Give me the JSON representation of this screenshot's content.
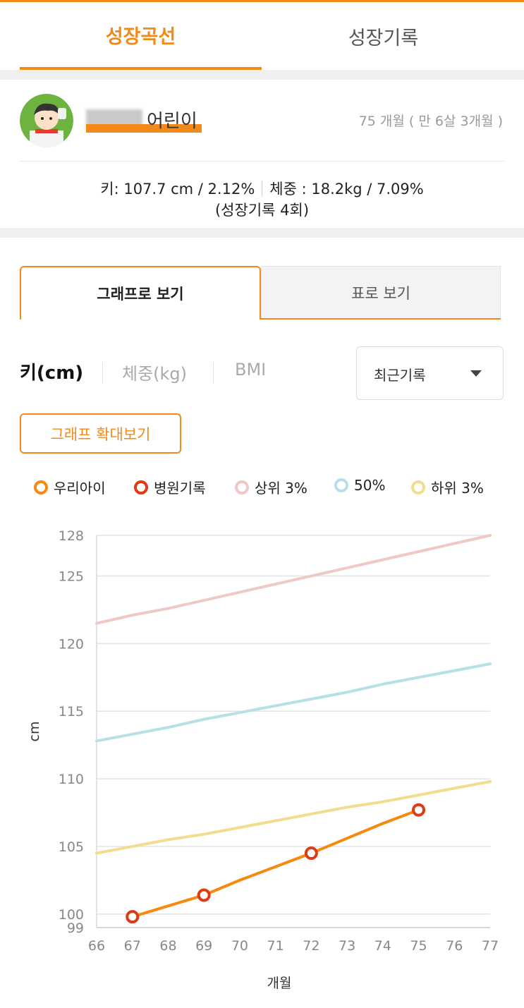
{
  "tabs": {
    "growth_curve": "성장곡선",
    "growth_records": "성장기록"
  },
  "profile": {
    "child_label": "어린이",
    "age_text": "75 개월 ( 만 6살 3개월 )",
    "height_stat": "키: 107.7 cm / 2.12%",
    "weight_stat": "체중 : 18.2kg / 7.09%",
    "record_count": "(성장기록 4회)"
  },
  "view_tabs": {
    "graph": "그래프로 보기",
    "table": "표로 보기"
  },
  "metrics": {
    "height": "키(cm)",
    "weight": "체중(kg)",
    "bmi": "BMI"
  },
  "select": {
    "value": "최근기록"
  },
  "zoom_button": "그래프 확대보기",
  "legend": {
    "mine": "우리아이",
    "hospital": "병원기록",
    "top3": "상위 3%",
    "p50": "50%",
    "bottom3": "하위 3%"
  },
  "colors": {
    "accent": "#f28a1a",
    "mine": "#f7890f",
    "hospital": "#e03a14",
    "top3": "#f0c9c6",
    "p50": "#b7e0e6",
    "bottom3": "#f2dc8e"
  },
  "chart_data": {
    "type": "line",
    "xlabel": "개월",
    "ylabel": "cm",
    "xlim": [
      66,
      77
    ],
    "ylim": [
      99,
      128
    ],
    "x_ticks": [
      "66",
      "67",
      "68",
      "69",
      "70",
      "71",
      "72",
      "73",
      "74",
      "75",
      "76",
      "77"
    ],
    "y_ticks": [
      "99",
      "100",
      "105",
      "110",
      "115",
      "120",
      "125",
      "128"
    ],
    "y_tick_values": [
      99,
      100,
      105,
      110,
      115,
      120,
      125,
      128
    ],
    "series": [
      {
        "name": "상위 3%",
        "key": "top3",
        "x": [
          66,
          67,
          68,
          69,
          70,
          71,
          72,
          73,
          74,
          75,
          76,
          77
        ],
        "y": [
          121.5,
          122.1,
          122.6,
          123.2,
          123.8,
          124.4,
          125.0,
          125.6,
          126.2,
          126.8,
          127.4,
          128.0
        ]
      },
      {
        "name": "50%",
        "key": "p50",
        "x": [
          66,
          67,
          68,
          69,
          70,
          71,
          72,
          73,
          74,
          75,
          76,
          77
        ],
        "y": [
          112.8,
          113.3,
          113.8,
          114.4,
          114.9,
          115.4,
          115.9,
          116.4,
          117.0,
          117.5,
          118.0,
          118.5
        ]
      },
      {
        "name": "하위 3%",
        "key": "bottom3",
        "x": [
          66,
          67,
          68,
          69,
          70,
          71,
          72,
          73,
          74,
          75,
          76,
          77
        ],
        "y": [
          104.5,
          105.0,
          105.5,
          105.9,
          106.4,
          106.9,
          107.4,
          107.9,
          108.3,
          108.8,
          109.3,
          109.8
        ]
      },
      {
        "name": "우리아이",
        "key": "mine",
        "x": [
          67,
          68,
          69,
          70,
          71,
          72,
          73,
          74,
          75
        ],
        "y": [
          99.8,
          100.6,
          101.4,
          102.5,
          103.5,
          104.5,
          105.6,
          106.7,
          107.7
        ],
        "markers_x": [
          67,
          69,
          72,
          75
        ],
        "markers_y": [
          99.8,
          101.4,
          104.5,
          107.7
        ]
      }
    ]
  }
}
